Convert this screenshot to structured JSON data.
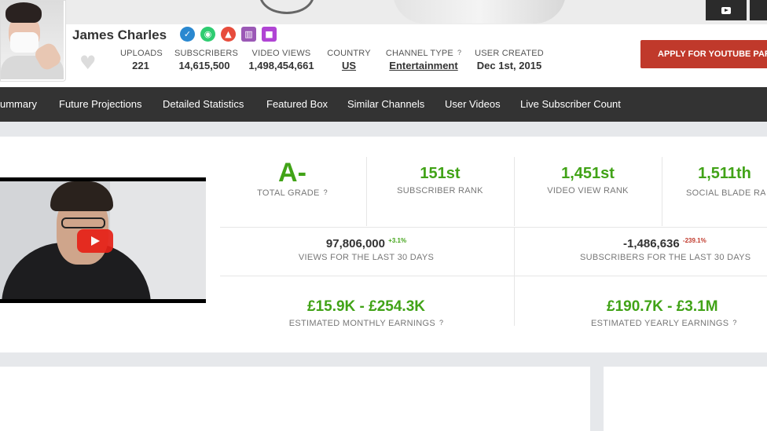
{
  "channel": {
    "name": "James Charles",
    "badges": [
      {
        "icon": "verified-check-icon",
        "glyph": "✓",
        "color": "#2a88d0"
      },
      {
        "icon": "eye-icon",
        "glyph": "◉",
        "color": "#2ecc71"
      },
      {
        "icon": "fire-icon",
        "glyph": "▲",
        "color": "#e74c3c"
      },
      {
        "icon": "bar-chart-icon",
        "glyph": "▥",
        "color": "#9b59b6"
      },
      {
        "icon": "video-camera-icon",
        "glyph": "■",
        "color": "#b044d4"
      }
    ]
  },
  "stats": {
    "uploads": {
      "label": "UPLOADS",
      "value": "221"
    },
    "subscribers": {
      "label": "SUBSCRIBERS",
      "value": "14,615,500"
    },
    "video_views": {
      "label": "VIDEO VIEWS",
      "value": "1,498,454,661"
    },
    "country": {
      "label": "COUNTRY",
      "value": "US"
    },
    "channel_type": {
      "label": "CHANNEL TYPE",
      "value": "Entertainment"
    },
    "user_created": {
      "label": "USER CREATED",
      "value": "Dec 1st, 2015"
    }
  },
  "apply_button": "APPLY FOR YOUTUBE PAR",
  "nav": [
    "ummary",
    "Future Projections",
    "Detailed Statistics",
    "Featured Box",
    "Similar Channels",
    "User Videos",
    "Live Subscriber Count"
  ],
  "grades": {
    "total_grade": {
      "value": "A-",
      "label": "TOTAL GRADE"
    },
    "subscriber_rank": {
      "value": "151st",
      "label": "SUBSCRIBER RANK"
    },
    "video_view_rank": {
      "value": "1,451st",
      "label": "VIDEO VIEW RANK"
    },
    "social_blade_rank": {
      "value": "1,511th",
      "label": "SOCIAL BLADE RAN"
    }
  },
  "last30": {
    "views": {
      "value": "97,806,000",
      "delta": "+3.1%",
      "label": "VIEWS FOR THE LAST 30 DAYS"
    },
    "subscribers": {
      "value": "-1,486,636",
      "delta": "-239.1%",
      "label": "SUBSCRIBERS FOR THE LAST 30 DAYS"
    }
  },
  "earnings": {
    "monthly": {
      "value": "£15.9K - £254.3K",
      "label": "ESTIMATED MONTHLY EARNINGS"
    },
    "yearly": {
      "value": "£190.7K - £3.1M",
      "label": "ESTIMATED YEARLY EARNINGS"
    }
  },
  "colors": {
    "accent_green": "#41a317",
    "apply_red": "#c0392b",
    "nav_bg": "#333333"
  }
}
